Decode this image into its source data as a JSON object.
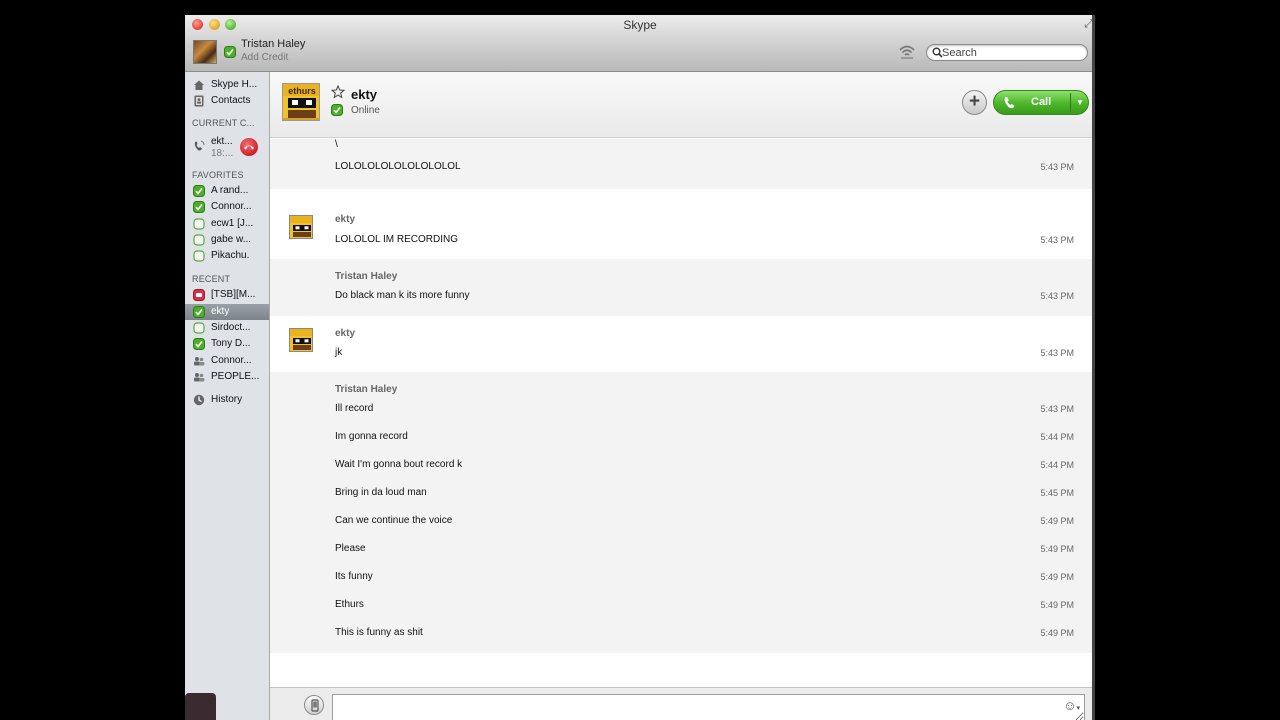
{
  "window": {
    "title": "Skype"
  },
  "profile": {
    "name": "Tristan Haley",
    "credit_link": "Add Credit"
  },
  "search": {
    "placeholder": "Search"
  },
  "sidebar": {
    "nav": [
      {
        "label": "Skype H...",
        "icon": "home-icon"
      },
      {
        "label": "Contacts",
        "icon": "contacts-icon"
      }
    ],
    "current_call_header": "CURRENT C...",
    "current_call": {
      "name": "ekt...",
      "duration": "18:..."
    },
    "favorites_header": "FAVORITES",
    "favorites": [
      "A rand...",
      "Connor...",
      "ecw1 [J...",
      "gabe w...",
      "Pikachu."
    ],
    "recent_header": "RECENT",
    "recent": [
      "[TSB][M...",
      "ekty",
      "Sirdoct...",
      "Tony D...",
      "Connor...",
      "PEOPLE..."
    ],
    "history_label": "History"
  },
  "conversation": {
    "contact_name": "ekty",
    "contact_status": "Online",
    "call_label": "Call",
    "avatar_text": "ethurs"
  },
  "messages": [
    {
      "sender": "",
      "lines": [
        {
          "text": "\\",
          "time": ""
        },
        {
          "text": "LOLOLOLOLOLOLOLOLOL",
          "time": "5:43 PM"
        }
      ]
    },
    {
      "sender": "ekty",
      "lines": [
        {
          "text": "LOLOLOL IM RECORDING",
          "time": "5:43 PM"
        }
      ]
    },
    {
      "sender": "Tristan Haley",
      "lines": [
        {
          "text": "Do black man k its more funny",
          "time": "5:43 PM"
        }
      ]
    },
    {
      "sender": "ekty",
      "lines": [
        {
          "text": "jk",
          "time": "5:43 PM"
        }
      ]
    },
    {
      "sender": "Tristan Haley",
      "lines": [
        {
          "text": "Ill record",
          "time": "5:43 PM"
        },
        {
          "text": "Im gonna record",
          "time": "5:44 PM"
        },
        {
          "text": "Wait I'm gonna bout record k",
          "time": "5:44 PM"
        },
        {
          "text": "Bring in da loud man",
          "time": "5:45 PM"
        },
        {
          "text": "Can we continue the voice",
          "time": "5:49 PM"
        },
        {
          "text": "Please",
          "time": "5:49 PM"
        },
        {
          "text": "Its funny",
          "time": "5:49 PM"
        },
        {
          "text": "Ethurs",
          "time": "5:49 PM"
        },
        {
          "text": "This is funny as shit",
          "time": "5:49 PM"
        }
      ]
    }
  ],
  "composer": {
    "value": ""
  },
  "colors": {
    "online_green": "#4caf2a",
    "call_green": "#4cb52a",
    "hangup_red": "#d21f2a",
    "sidebar_bg": "#dfe3e8"
  }
}
